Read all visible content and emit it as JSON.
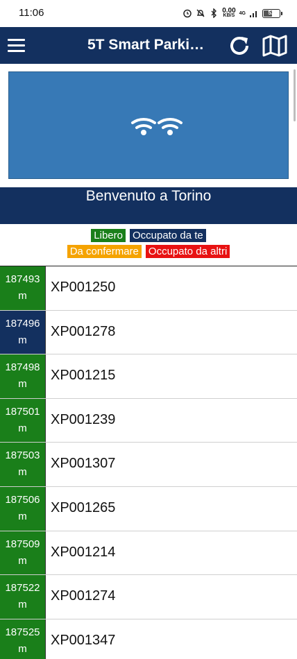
{
  "status_bar": {
    "time": "11:06",
    "net_speed_value": "0.00",
    "net_speed_unit": "KB/S",
    "network": "4G",
    "battery": "52"
  },
  "app_bar": {
    "title": "5T Smart Parki…",
    "menu_icon": "hamburger-menu-icon",
    "refresh_icon": "refresh-icon",
    "map_icon": "map-icon"
  },
  "banner": {
    "icon": "wifi-icon",
    "color": "#3779b6"
  },
  "welcome": {
    "text": "Benvenuto a Torino"
  },
  "legend": {
    "free": {
      "label": "Libero",
      "color": "#1a7f1a"
    },
    "occupied_you": {
      "label": "Occupato da te",
      "color": "#13305f"
    },
    "to_confirm": {
      "label": "Da confermare",
      "color": "#f5a300"
    },
    "occupied_others": {
      "label": "Occupato da altri",
      "color": "#e81212"
    }
  },
  "parking_list": [
    {
      "distance": "187493",
      "unit": "m",
      "code": "XP001250",
      "status": "free"
    },
    {
      "distance": "187496",
      "unit": "m",
      "code": "XP001278",
      "status": "occupied_you"
    },
    {
      "distance": "187498",
      "unit": "m",
      "code": "XP001215",
      "status": "free"
    },
    {
      "distance": "187501",
      "unit": "m",
      "code": "XP001239",
      "status": "free"
    },
    {
      "distance": "187503",
      "unit": "m",
      "code": "XP001307",
      "status": "free"
    },
    {
      "distance": "187506",
      "unit": "m",
      "code": "XP001265",
      "status": "free"
    },
    {
      "distance": "187509",
      "unit": "m",
      "code": "XP001214",
      "status": "free"
    },
    {
      "distance": "187522",
      "unit": "m",
      "code": "XP001274",
      "status": "free"
    },
    {
      "distance": "187525",
      "unit": "m",
      "code": "XP001347",
      "status": "free"
    }
  ]
}
